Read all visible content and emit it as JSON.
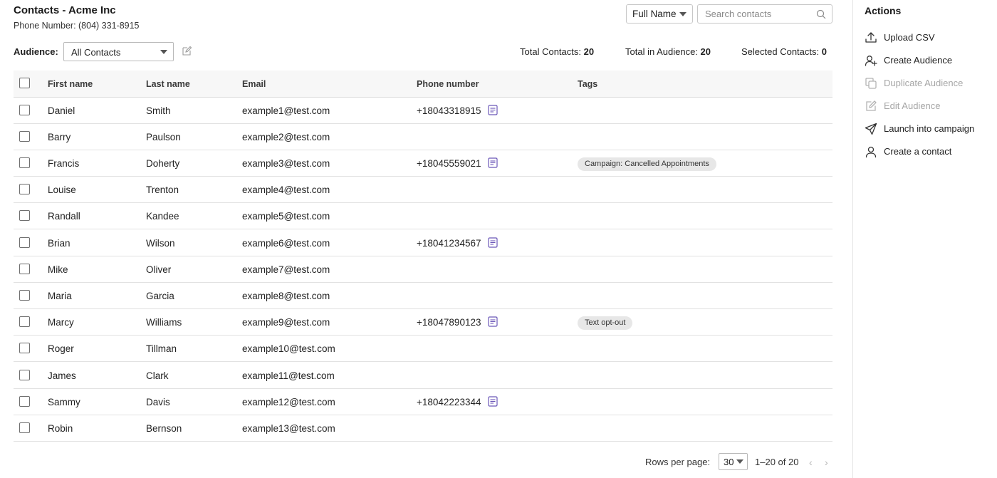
{
  "header": {
    "title": "Contacts - Acme Inc",
    "phone_line": "Phone Number: (804) 331-8915",
    "sort_select": "Full Name",
    "search_placeholder": "Search contacts"
  },
  "audience": {
    "label": "Audience:",
    "selected": "All Contacts"
  },
  "stats": {
    "total_label": "Total Contacts:",
    "total_value": "20",
    "audience_label": "Total in Audience:",
    "audience_value": "20",
    "selected_label": "Selected Contacts:",
    "selected_value": "0"
  },
  "table": {
    "columns": [
      "First name",
      "Last name",
      "Email",
      "Phone number",
      "Tags"
    ],
    "rows": [
      {
        "first": "Daniel",
        "last": "Smith",
        "email": "example1@test.com",
        "phone": "+18043318915",
        "tag": ""
      },
      {
        "first": "Barry",
        "last": "Paulson",
        "email": "example2@test.com",
        "phone": "",
        "tag": ""
      },
      {
        "first": "Francis",
        "last": "Doherty",
        "email": "example3@test.com",
        "phone": "+18045559021",
        "tag": "Campaign: Cancelled Appointments"
      },
      {
        "first": "Louise",
        "last": "Trenton",
        "email": "example4@test.com",
        "phone": "",
        "tag": ""
      },
      {
        "first": "Randall",
        "last": "Kandee",
        "email": "example5@test.com",
        "phone": "",
        "tag": ""
      },
      {
        "first": "Brian",
        "last": "Wilson",
        "email": "example6@test.com",
        "phone": "+18041234567",
        "tag": ""
      },
      {
        "first": "Mike",
        "last": "Oliver",
        "email": "example7@test.com",
        "phone": "",
        "tag": ""
      },
      {
        "first": "Maria",
        "last": "Garcia",
        "email": "example8@test.com",
        "phone": "",
        "tag": ""
      },
      {
        "first": "Marcy",
        "last": "Williams",
        "email": "example9@test.com",
        "phone": "+18047890123",
        "tag": "Text opt-out"
      },
      {
        "first": "Roger",
        "last": "Tillman",
        "email": "example10@test.com",
        "phone": "",
        "tag": ""
      },
      {
        "first": "James",
        "last": "Clark",
        "email": "example11@test.com",
        "phone": "",
        "tag": ""
      },
      {
        "first": "Sammy",
        "last": "Davis",
        "email": "example12@test.com",
        "phone": "+18042223344",
        "tag": ""
      },
      {
        "first": "Robin",
        "last": "Bernson",
        "email": "example13@test.com",
        "phone": "",
        "tag": ""
      }
    ]
  },
  "pagination": {
    "rows_per_page_label": "Rows per page:",
    "rows_per_page_value": "30",
    "range": "1–20 of 20"
  },
  "sidebar": {
    "title": "Actions",
    "items": [
      {
        "label": "Upload CSV",
        "icon": "upload-icon",
        "disabled": false
      },
      {
        "label": "Create Audience",
        "icon": "user-plus-icon",
        "disabled": false
      },
      {
        "label": "Duplicate Audience",
        "icon": "copy-icon",
        "disabled": true
      },
      {
        "label": "Edit Audience",
        "icon": "edit-icon",
        "disabled": true
      },
      {
        "label": "Launch into campaign",
        "icon": "send-icon",
        "disabled": false
      },
      {
        "label": "Create a contact",
        "icon": "user-icon",
        "disabled": false
      }
    ]
  },
  "colors": {
    "note_icon": "#6b57b8",
    "tag_background": "#e7e7e7",
    "disabled_text": "#a6a6a6"
  }
}
